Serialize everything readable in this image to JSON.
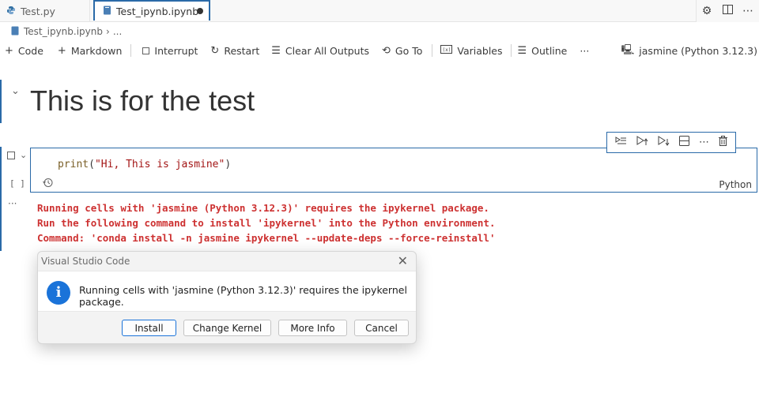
{
  "tabs": [
    {
      "label": "Test.py",
      "icon": "python-icon"
    },
    {
      "label": "Test_ipynb.ipynb",
      "icon": "notebook-icon",
      "modified": true
    }
  ],
  "breadcrumb": {
    "file": "Test_ipynb.ipynb",
    "rest": "..."
  },
  "toolbar": {
    "code": "Code",
    "markdown": "Markdown",
    "interrupt": "Interrupt",
    "restart": "Restart",
    "clear_all": "Clear All Outputs",
    "go_to": "Go To",
    "variables": "Variables",
    "outline": "Outline",
    "more": "···",
    "kernel": "jasmine (Python 3.12.3)"
  },
  "notebook": {
    "markdown_heading": "This is for the test",
    "code_cell": {
      "code_fn": "print",
      "code_open": "(",
      "code_str": "\"Hi, This is jasmine\"",
      "code_close": ")",
      "exec_count": "[ ]",
      "language": "Python"
    },
    "output_lines": [
      "Running cells with 'jasmine (Python 3.12.3)' requires the ipykernel package.",
      "Run the following command to install 'ipykernel' into the Python environment.",
      "Command: 'conda install -n jasmine ipykernel --update-deps --force-reinstall'"
    ],
    "output_dots": "···"
  },
  "dialog": {
    "title": "Visual Studio Code",
    "message": "Running cells with 'jasmine (Python 3.12.3)' requires the ipykernel package.",
    "buttons": {
      "install": "Install",
      "change_kernel": "Change Kernel",
      "more_info": "More Info",
      "cancel": "Cancel"
    }
  },
  "colors": {
    "accent": "#2a6aa8",
    "error": "#cd3131",
    "info": "#1a73d9"
  }
}
